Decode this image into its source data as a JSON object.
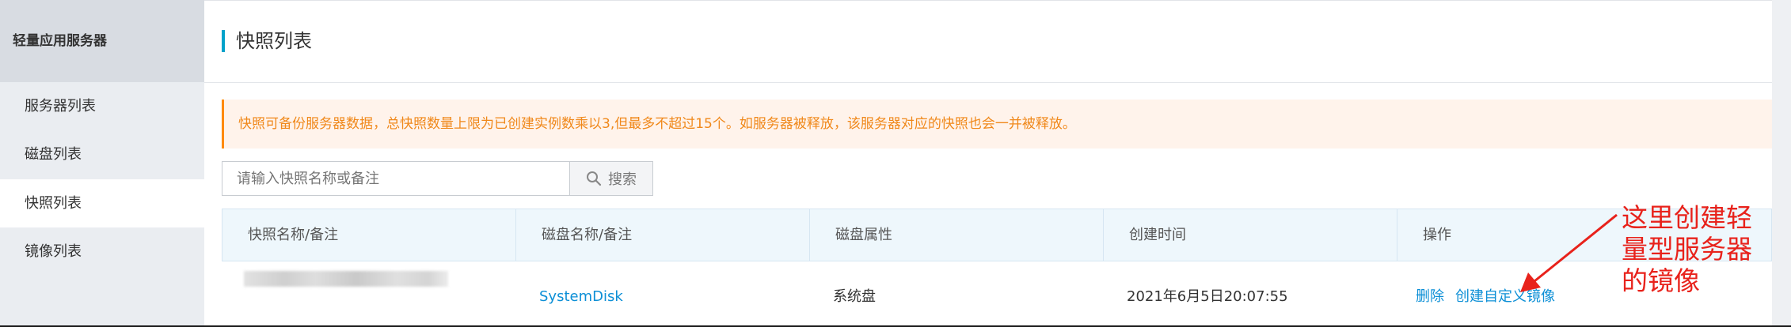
{
  "sidebar": {
    "header": "轻量应用服务器",
    "items": [
      {
        "label": "服务器列表",
        "active": false
      },
      {
        "label": "磁盘列表",
        "active": false
      },
      {
        "label": "快照列表",
        "active": true
      },
      {
        "label": "镜像列表",
        "active": false
      }
    ]
  },
  "page": {
    "title": "快照列表"
  },
  "notice": {
    "text": "快照可备份服务器数据，总快照数量上限为已创建实例数乘以3,但最多不超过15个。如服务器被释放，该服务器对应的快照也会一并被释放。"
  },
  "search": {
    "placeholder": "请输入快照名称或备注",
    "button_label": "搜索",
    "icon": "search-icon"
  },
  "table": {
    "columns": [
      "快照名称/备注",
      "磁盘名称/备注",
      "磁盘属性",
      "创建时间",
      "操作"
    ],
    "rows": [
      {
        "disk_name": "SystemDisk",
        "disk_type": "系统盘",
        "created": "2021年6月5日20:07:55",
        "actions": {
          "delete": "删除",
          "create_image": "创建自定义镜像"
        }
      }
    ]
  },
  "annotation": {
    "lines": [
      "这里创建轻",
      "量型服务器",
      "的镜像"
    ]
  },
  "colors": {
    "accent": "#00a2ca",
    "link": "#0c8fd6",
    "notice_text": "#f0881a",
    "annotation": "#e8221b"
  }
}
